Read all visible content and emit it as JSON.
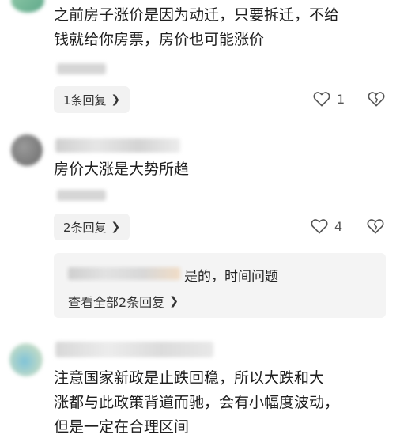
{
  "comments": [
    {
      "text_lines": [
        "之前房子涨价是因为动迁，只要拆迁，不给",
        "钱就给你房票，房价也可能涨价"
      ],
      "replies_label": "1条回复",
      "like_count": "1"
    },
    {
      "text_lines": [
        "房价大涨是大势所趋"
      ],
      "replies_label": "2条回复",
      "like_count": "4",
      "quoted_reply": {
        "text": "是的，时间问题",
        "view_all_label": "查看全部2条回复"
      }
    },
    {
      "text_lines": [
        "注意国家新政是止跌回稳，所以大跌和大",
        "涨都与此政策背道而驰，会有小幅度波动，",
        "但是一定在合理区间"
      ]
    }
  ],
  "icons": {
    "like": "heart-outline-icon",
    "dislike": "broken-heart-icon",
    "chevron": "chevron-right-icon"
  }
}
